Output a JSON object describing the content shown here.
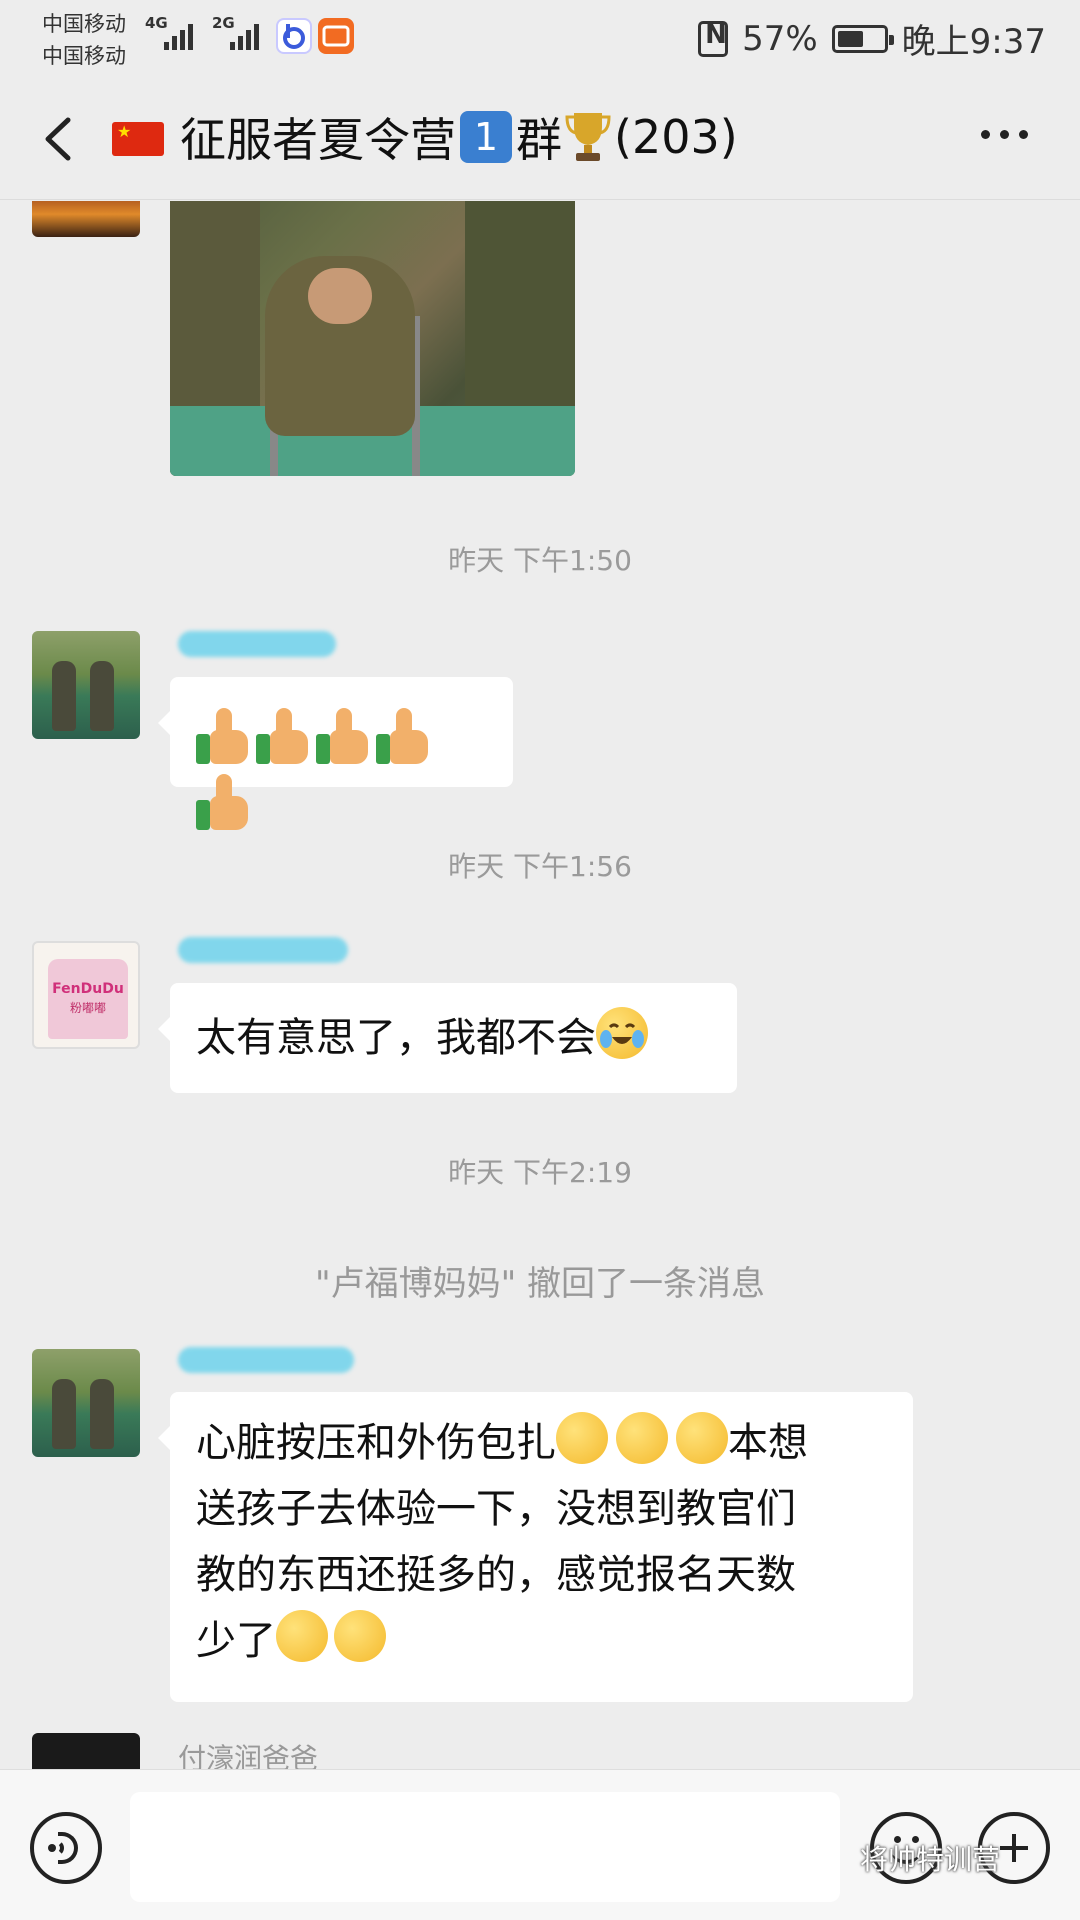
{
  "status_bar": {
    "carrier1": "中国移动",
    "carrier2": "中国移动",
    "net1": "4G",
    "net2": "2G",
    "nfc_label": "N",
    "battery_percent": "57%",
    "battery_level": 0.57,
    "time": "晚上9:37"
  },
  "header": {
    "title_prefix": "征服者夏令营",
    "badge": "1",
    "title_middle": "群",
    "member_count": "(203)"
  },
  "messages": [
    {
      "type": "image",
      "sender_avatar": "sunset"
    },
    {
      "type": "timestamp",
      "text": "昨天 下午1:50"
    },
    {
      "type": "emoji",
      "emoji": "thumbs-up",
      "count": 5
    },
    {
      "type": "timestamp",
      "text": "昨天 下午1:56"
    },
    {
      "type": "text",
      "text": "太有意思了，我都不会",
      "trailing_emoji": "face-with-tears"
    },
    {
      "type": "timestamp",
      "text": "昨天 下午2:19"
    },
    {
      "type": "system",
      "text": "\"卢福博妈妈\" 撤回了一条消息"
    },
    {
      "type": "text",
      "lines": [
        "心脏按压和外伤包扎",
        "本想",
        "送孩子去体验一下，没想到教官们",
        "教的东西还挺多的，感觉报名天数",
        "少了"
      ]
    },
    {
      "type": "sender_only",
      "sender": "付濠润爸爸"
    }
  ],
  "avatar_brand": {
    "line1": "FenDuDu",
    "line2": "粉嘟嘟"
  },
  "input_bar": {
    "placeholder": "",
    "watermark": "将帅特训营"
  },
  "colors": {
    "background": "#ededed",
    "bubble": "#ffffff",
    "timestamp_text": "#9a9a9a",
    "name_blur": "#6fd3ec"
  }
}
